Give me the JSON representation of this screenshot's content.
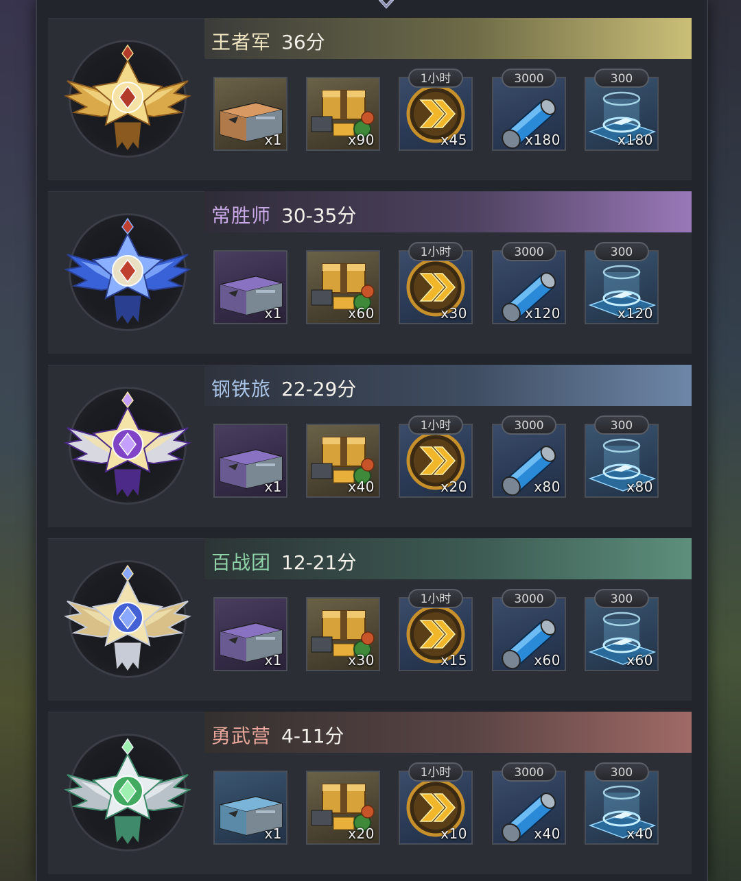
{
  "tiers": [
    {
      "name": "王者军",
      "score": "36分",
      "name_color": "#f1e6c2",
      "banner": [
        "#3b3c3a",
        "#6e6b47",
        "#cbbf77"
      ],
      "emblem": "gold-eagle-emblem",
      "items": [
        {
          "icon": "bronze-supply-crate-icon",
          "quality": "gold",
          "qty": "x1",
          "tag": ""
        },
        {
          "icon": "resource-bundle-icon",
          "quality": "gold",
          "qty": "x90",
          "tag": ""
        },
        {
          "icon": "speedup-chevron-icon",
          "quality": "navy",
          "qty": "x45",
          "tag": "1小时"
        },
        {
          "icon": "fuel-canister-icon",
          "quality": "navy",
          "qty": "x180",
          "tag": "3000"
        },
        {
          "icon": "hologram-pad-icon",
          "quality": "blue",
          "qty": "x180",
          "tag": "300"
        }
      ]
    },
    {
      "name": "常胜师",
      "score": "30-35分",
      "name_color": "#c8a8e6",
      "banner": [
        "#2f2c38",
        "#4e4260",
        "#9a78b8"
      ],
      "emblem": "blue-winged-emblem",
      "items": [
        {
          "icon": "purple-supply-crate-icon",
          "quality": "purple",
          "qty": "x1",
          "tag": ""
        },
        {
          "icon": "resource-bundle-icon",
          "quality": "gold",
          "qty": "x60",
          "tag": ""
        },
        {
          "icon": "speedup-chevron-icon",
          "quality": "navy",
          "qty": "x30",
          "tag": "1小时"
        },
        {
          "icon": "fuel-canister-icon",
          "quality": "navy",
          "qty": "x120",
          "tag": "3000"
        },
        {
          "icon": "hologram-pad-icon",
          "quality": "blue",
          "qty": "x120",
          "tag": "300"
        }
      ]
    },
    {
      "name": "钢铁旅",
      "score": "22-29分",
      "name_color": "#a9c4e6",
      "banner": [
        "#2e323c",
        "#3f4d62",
        "#6e87a8"
      ],
      "emblem": "purple-shield-emblem",
      "items": [
        {
          "icon": "purple-supply-crate-icon",
          "quality": "purple",
          "qty": "x1",
          "tag": ""
        },
        {
          "icon": "resource-bundle-icon",
          "quality": "gold",
          "qty": "x40",
          "tag": ""
        },
        {
          "icon": "speedup-chevron-icon",
          "quality": "navy",
          "qty": "x20",
          "tag": "1小时"
        },
        {
          "icon": "fuel-canister-icon",
          "quality": "navy",
          "qty": "x80",
          "tag": "3000"
        },
        {
          "icon": "hologram-pad-icon",
          "quality": "blue",
          "qty": "x80",
          "tag": "300"
        }
      ]
    },
    {
      "name": "百战团",
      "score": "12-21分",
      "name_color": "#8fd3a8",
      "banner": [
        "#2c3436",
        "#3c5a52",
        "#5d8f7c"
      ],
      "emblem": "blue-star-emblem",
      "items": [
        {
          "icon": "purple-supply-crate-icon",
          "quality": "purple",
          "qty": "x1",
          "tag": ""
        },
        {
          "icon": "resource-bundle-icon",
          "quality": "gold",
          "qty": "x30",
          "tag": ""
        },
        {
          "icon": "speedup-chevron-icon",
          "quality": "navy",
          "qty": "x15",
          "tag": "1小时"
        },
        {
          "icon": "fuel-canister-icon",
          "quality": "navy",
          "qty": "x60",
          "tag": "3000"
        },
        {
          "icon": "hologram-pad-icon",
          "quality": "blue",
          "qty": "x60",
          "tag": "300"
        }
      ]
    },
    {
      "name": "勇武营",
      "score": "4-11分",
      "name_color": "#e8a79a",
      "banner": [
        "#33302f",
        "#5a4444",
        "#a06a66"
      ],
      "emblem": "green-star-emblem",
      "items": [
        {
          "icon": "blue-supply-crate-icon",
          "quality": "blue",
          "qty": "x1",
          "tag": ""
        },
        {
          "icon": "resource-bundle-icon",
          "quality": "gold",
          "qty": "x20",
          "tag": ""
        },
        {
          "icon": "speedup-chevron-icon",
          "quality": "navy",
          "qty": "x10",
          "tag": "1小时"
        },
        {
          "icon": "fuel-canister-icon",
          "quality": "navy",
          "qty": "x40",
          "tag": "3000"
        },
        {
          "icon": "hologram-pad-icon",
          "quality": "blue",
          "qty": "x40",
          "tag": "300"
        }
      ]
    }
  ]
}
